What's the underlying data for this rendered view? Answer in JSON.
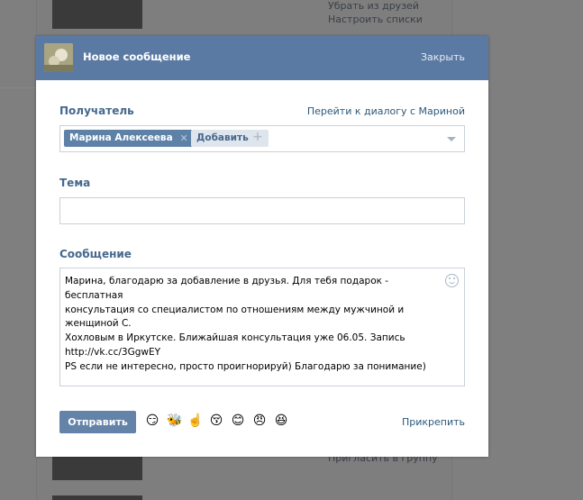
{
  "background": {
    "links": [
      "Убрать из друзей",
      "Настроить списки",
      "Пригласить в группу"
    ]
  },
  "dialog": {
    "title": "Новое сообщение",
    "close_label": "Закрыть",
    "recipient_label": "Получатель",
    "goto_dialog_link": "Перейти к диалогу с Мариной",
    "recipient_chip": "Марина Алексеева",
    "add_label": "Добавить",
    "subject_label": "Тема",
    "subject_value": "",
    "message_label": "Сообщение",
    "message_text": "Марина, благодарю за добавление в друзья. Для тебя подарок - бесплатная\nконсультация со специалистом по отношениям между мужчиной и женщиной С.\nХохловым в Иркутске. Ближайшая консультация уже 06.05. Запись\nhttp://vk.cc/3GgwEY\nPS если не интересно, просто проигнорируй) Благодарю за понимание)",
    "send_label": "Отправить",
    "attach_label": "Прикрепить",
    "emojis": [
      "😏",
      "🐝",
      "☝️",
      "😚",
      "😊",
      "😠",
      "😆"
    ]
  },
  "colors": {
    "header": "#5b7aa3",
    "link": "#2b587a",
    "label": "#45688e"
  }
}
